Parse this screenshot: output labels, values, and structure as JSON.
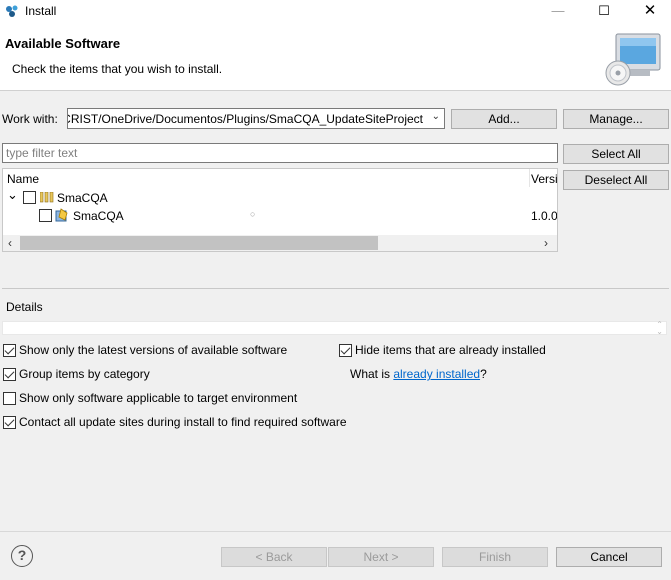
{
  "window": {
    "title": "Install",
    "minimize": "—",
    "maximize": "☐",
    "close": "✕"
  },
  "header": {
    "title": "Available Software",
    "description": "Check the items that you wish to install."
  },
  "work_with": {
    "label": "Work with:",
    "value": "C:/Users/CRIST/OneDrive/Documentos/Plugins/SmaCQA_UpdateSiteProject/",
    "add_label": "Add...",
    "manage_label": "Manage..."
  },
  "filter": {
    "placeholder": "type filter text"
  },
  "side_buttons": {
    "select_all": "Select All",
    "deselect_all": "Deselect All"
  },
  "tree": {
    "columns": [
      "Name",
      "Versi"
    ],
    "rows": [
      {
        "name": "SmaCQA",
        "version": "",
        "checked": false,
        "kind": "category",
        "expanded": true
      },
      {
        "name": "SmaCQA",
        "version": "1.0.0",
        "checked": false,
        "kind": "feature"
      }
    ],
    "scroll_left": "‹",
    "scroll_right": "›",
    "expand_glyph": "⌄",
    "dot": "○"
  },
  "details": {
    "label": "Details"
  },
  "options": {
    "latest_versions": {
      "label": "Show only the latest versions of available software",
      "checked": true
    },
    "hide_installed": {
      "label": "Hide items that are already installed",
      "checked": true
    },
    "group_by_category": {
      "label": "Group items by category",
      "checked": true
    },
    "what_is": "What is ",
    "already_installed_link": "already installed",
    "question_mark": "?",
    "target_env": {
      "label": "Show only software applicable to target environment",
      "checked": false
    },
    "contact_sites": {
      "label": "Contact all update sites during install to find required software",
      "checked": true
    }
  },
  "footer": {
    "help": "?",
    "back": "< Back",
    "next": "Next >",
    "finish": "Finish",
    "cancel": "Cancel"
  },
  "colors": {
    "link": "#0066cc",
    "dialog_bg": "#f0f0f0",
    "header_bg": "#ffffff"
  }
}
